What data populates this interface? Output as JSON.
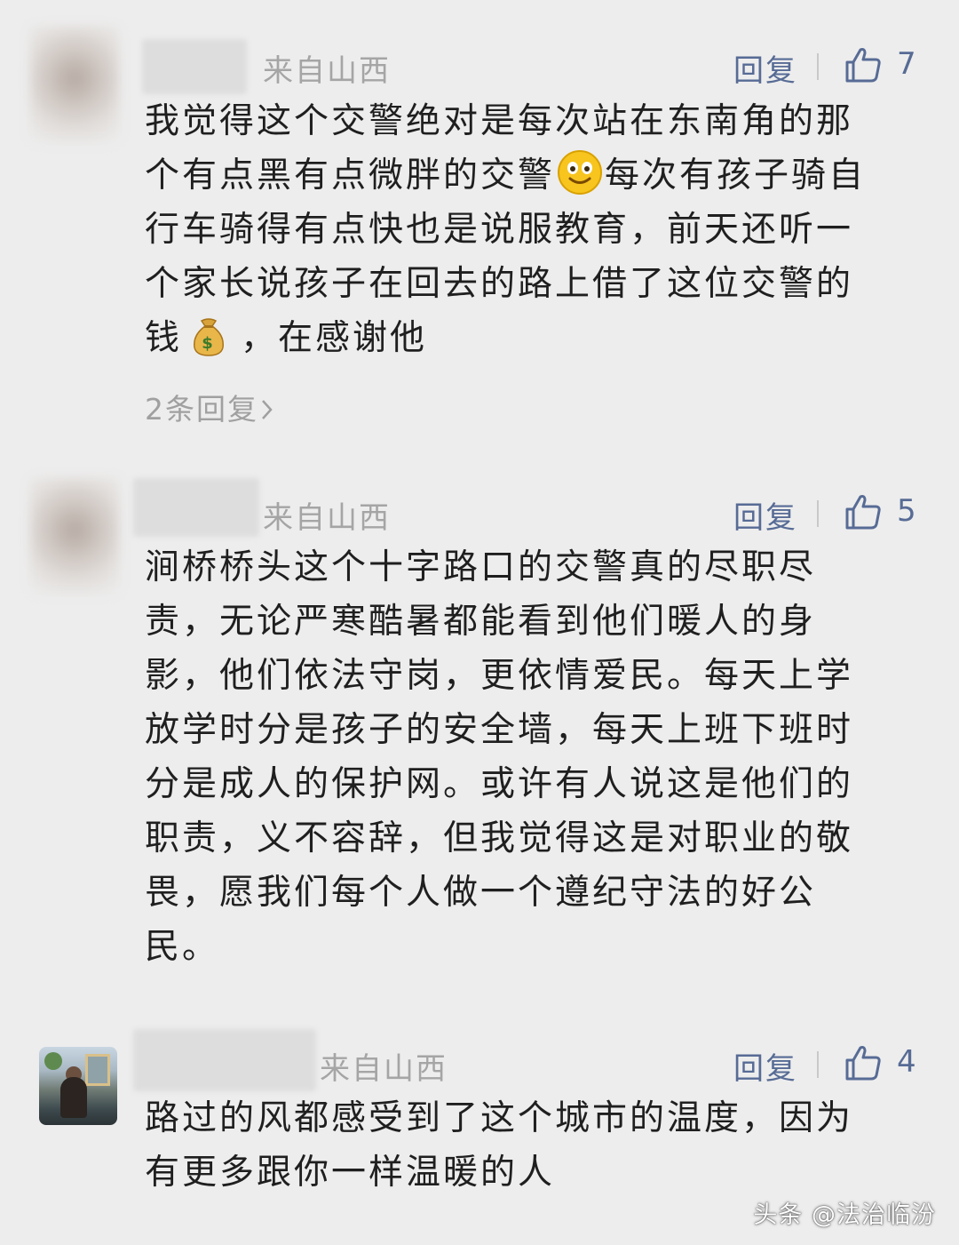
{
  "comments": [
    {
      "location": "来自山西",
      "reply_label": "回复",
      "likes": "7",
      "lines": [
        "我觉得这个交警绝对是每次站在东南角的那",
        "个有点黑有点微胖的交警",
        "每次有孩子骑自",
        "行车骑得有点快也是说服教育，前天还听一",
        "个家长说孩子在回去的路上借了这位交警的",
        "钱",
        "，在感谢他"
      ],
      "emoji_1": "smile-emoji",
      "emoji_2": "money-bag-emoji",
      "sub_replies": "2条回复"
    },
    {
      "location": "来自山西",
      "reply_label": "回复",
      "likes": "5",
      "lines": [
        "涧桥桥头这个十字路口的交警真的尽职尽",
        "责，无论严寒酷暑都能看到他们暖人的身",
        "影，他们依法守岗，更依情爱民。每天上学",
        "放学时分是孩子的安全墙，每天上班下班时",
        "分是成人的保护网。或许有人说这是他们的",
        "职责，义不容辞，但我觉得这是对职业的敬",
        "畏，愿我们每个人做一个遵纪守法的好公",
        "民。"
      ]
    },
    {
      "location": "来自山西",
      "reply_label": "回复",
      "likes": "4",
      "lines": [
        "路过的风都感受到了这个城市的温度，因为",
        "有更多跟你一样温暖的人"
      ]
    }
  ],
  "watermark": "头条 @法治临汾",
  "colors": {
    "background": "#ededed",
    "link": "#576b95",
    "meta": "#a5a5a5",
    "text": "#1f1f1f"
  },
  "icons": {
    "like": "thumbs-up-icon",
    "sub_replies_arrow": "chevron-right-icon"
  }
}
